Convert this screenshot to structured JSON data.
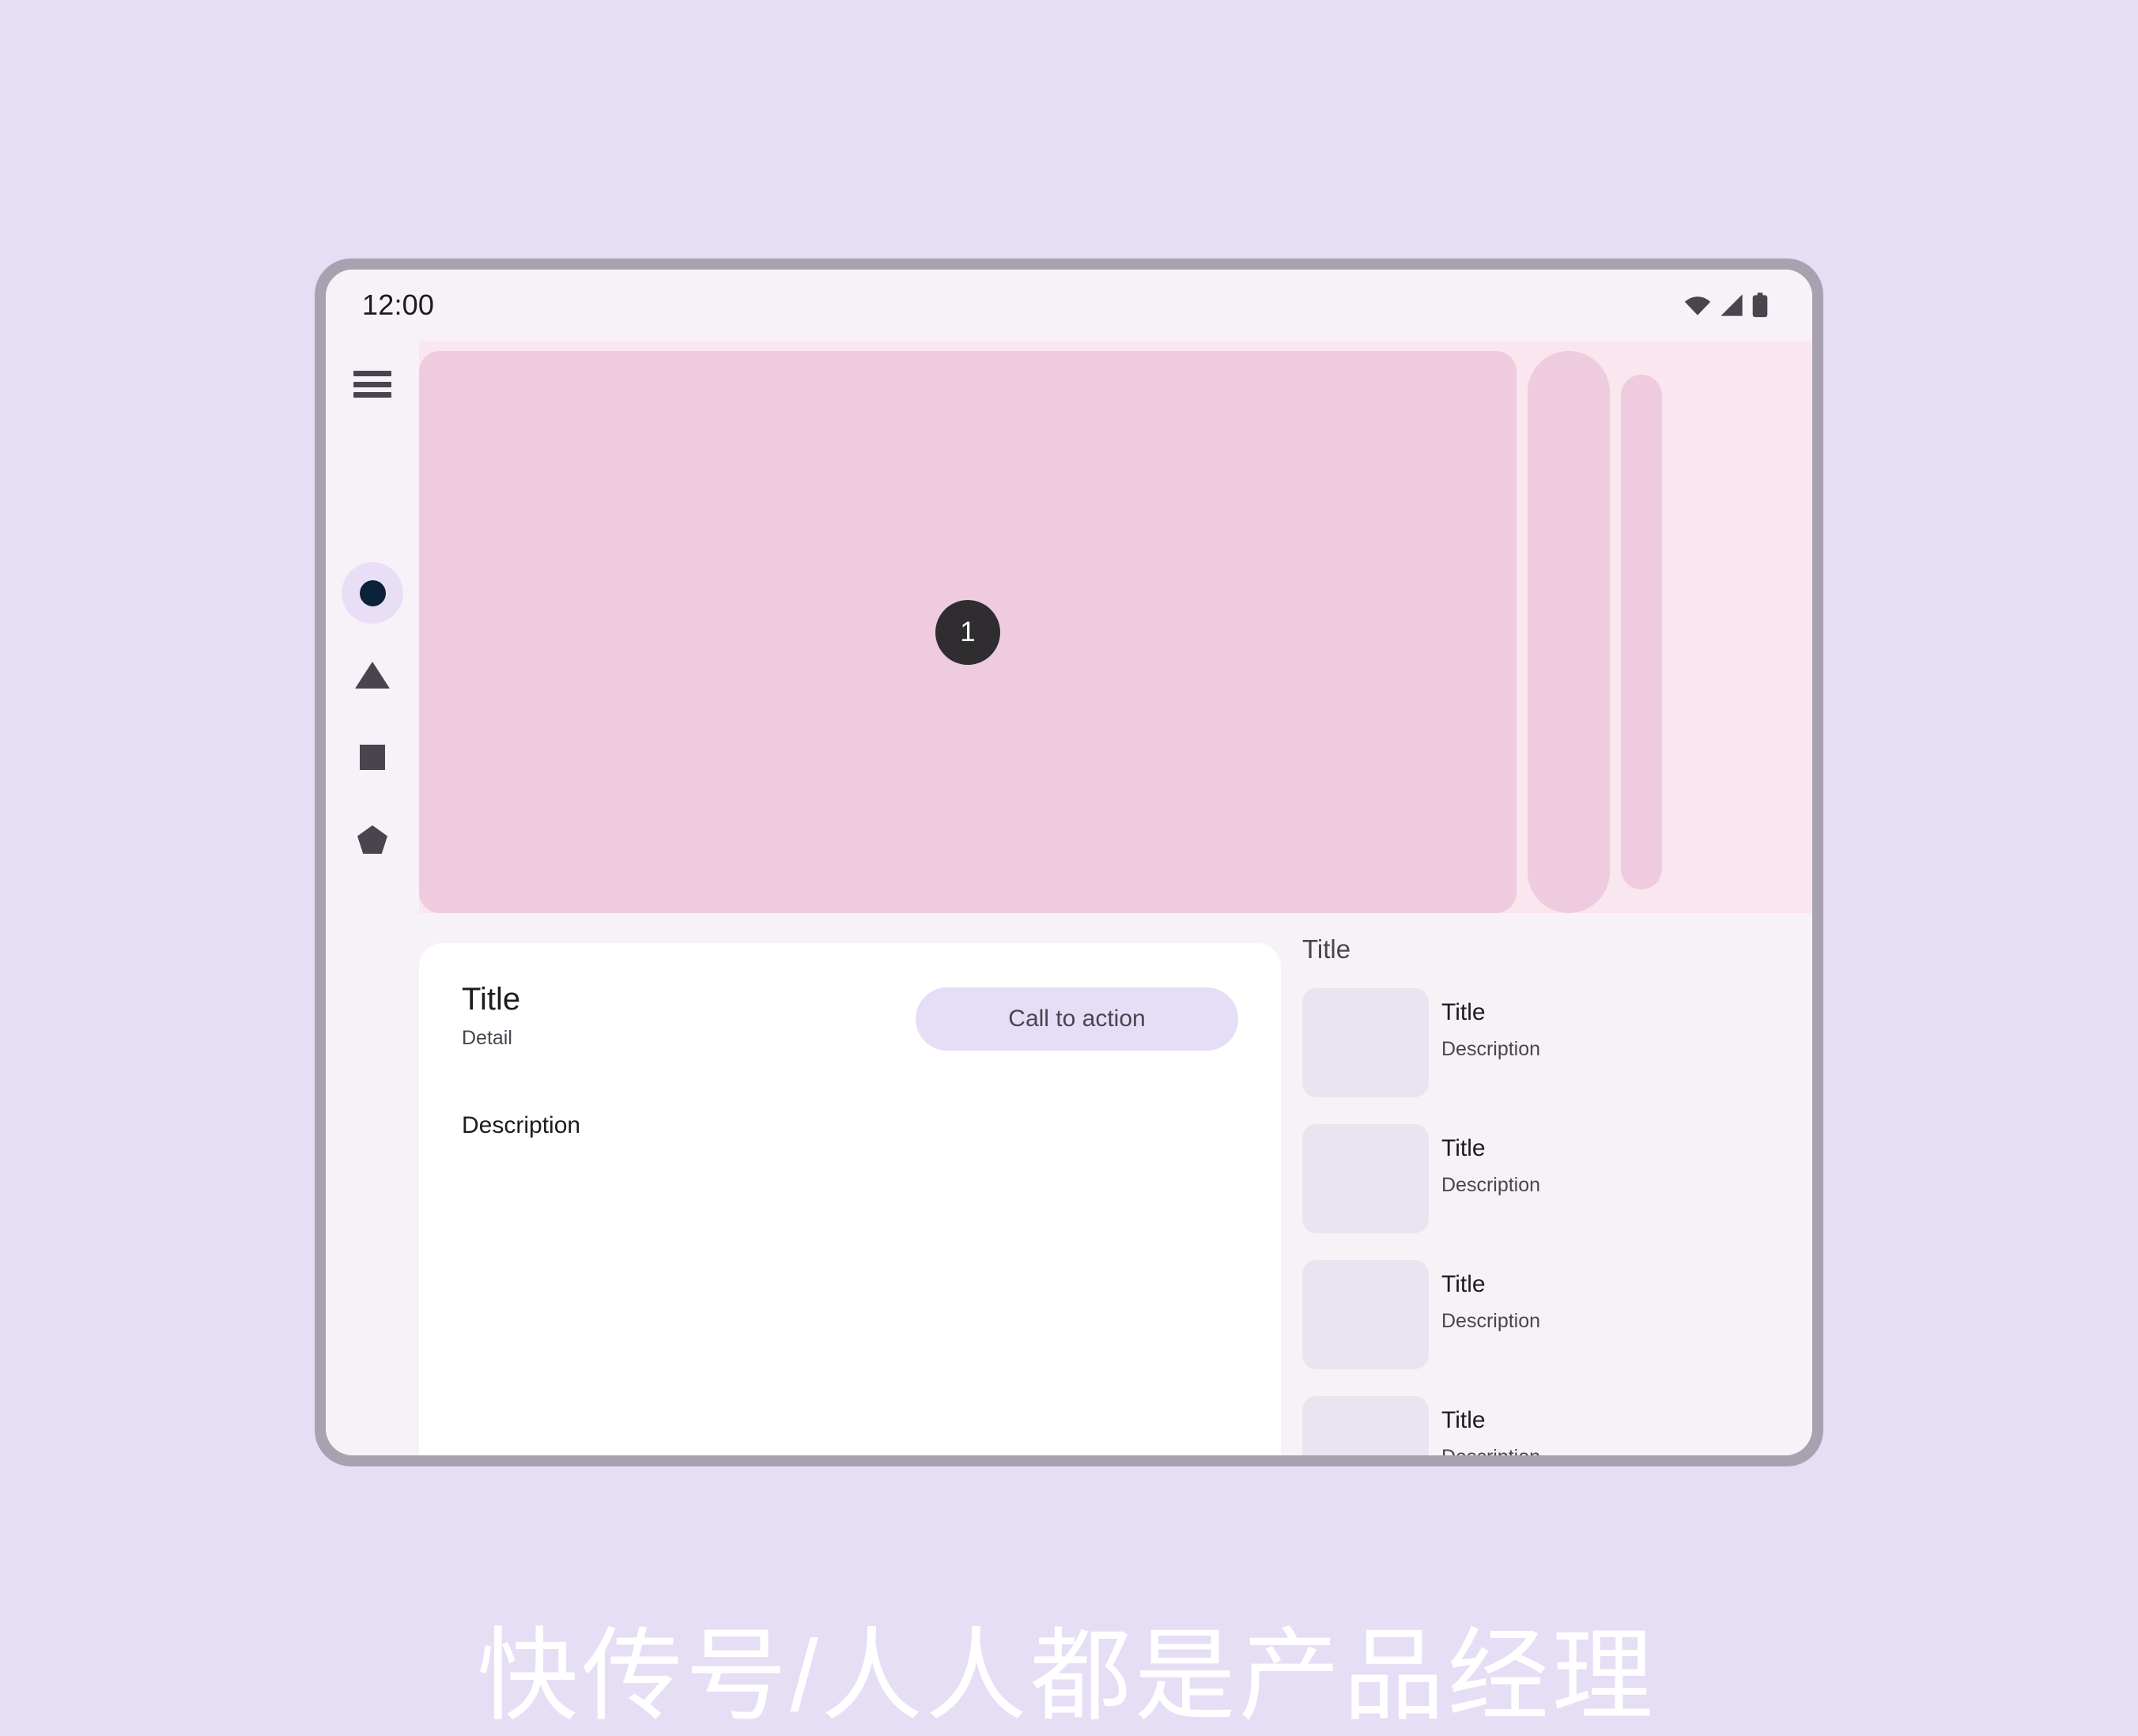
{
  "status_bar": {
    "time": "12:00",
    "icons": [
      "wifi-icon",
      "signal-icon",
      "battery-icon"
    ]
  },
  "nav_rail": {
    "menu_icon": "hamburger-menu-icon",
    "items": [
      {
        "icon": "circle-icon",
        "selected": true
      },
      {
        "icon": "triangle-icon",
        "selected": false
      },
      {
        "icon": "square-icon",
        "selected": false
      },
      {
        "icon": "pentagon-icon",
        "selected": false
      }
    ]
  },
  "carousel": {
    "badge": "1",
    "items": [
      {
        "size": "main"
      },
      {
        "size": "med"
      },
      {
        "size": "small"
      }
    ]
  },
  "detail": {
    "title": "Title",
    "subtitle": "Detail",
    "cta_label": "Call to action",
    "description": "Description"
  },
  "list_panel": {
    "header": "Title",
    "items": [
      {
        "title": "Title",
        "description": "Description"
      },
      {
        "title": "Title",
        "description": "Description"
      },
      {
        "title": "Title",
        "description": "Description"
      },
      {
        "title": "Title",
        "description": "Description"
      }
    ]
  },
  "watermark": "快传号/人人都是产品经理",
  "colors": {
    "page_background": "#E5DEF5",
    "device_frame": "#A8A2B0",
    "surface": "#F7F2F8",
    "carousel_background": "#FAE6EE",
    "carousel_item": "#EFCBE0",
    "accent": "#E6DEF7",
    "on_surface": "#1C1B1F",
    "on_surface_variant": "#49454F",
    "badge": "#2F2D30",
    "selected_indicator": "#0B2238",
    "thumb": "#EAE4F0",
    "card": "#FFFFFF"
  }
}
